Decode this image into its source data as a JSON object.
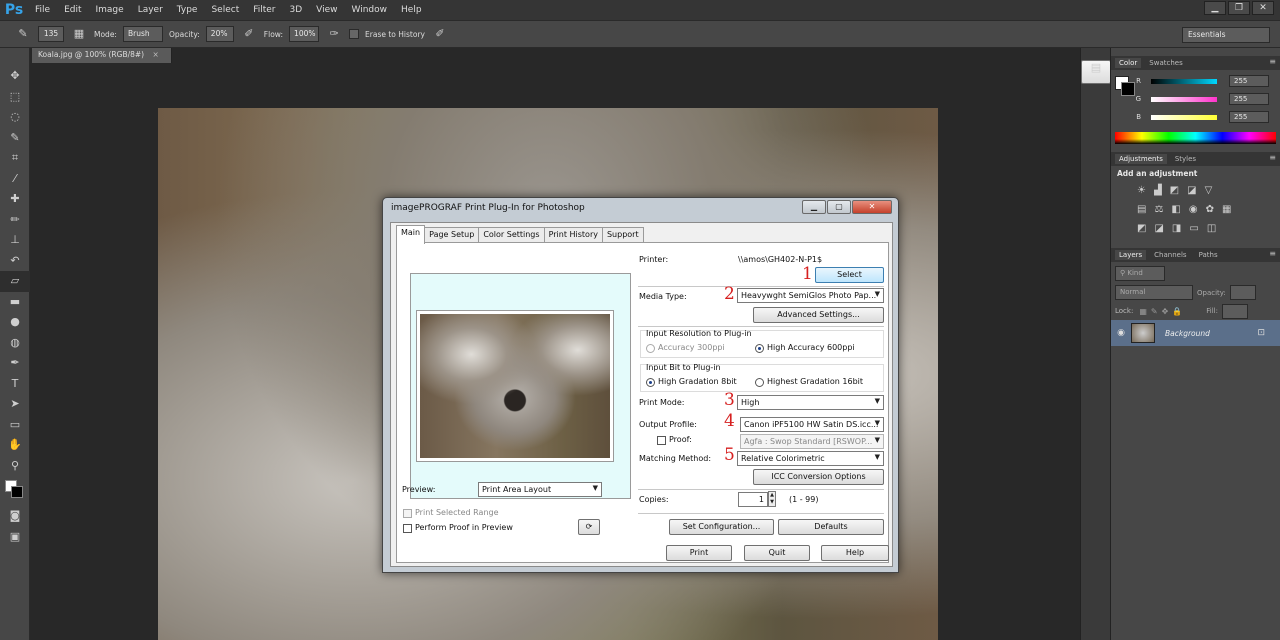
{
  "app": {
    "logo": "Ps",
    "menu": [
      "File",
      "Edit",
      "Image",
      "Layer",
      "Type",
      "Select",
      "Filter",
      "3D",
      "View",
      "Window",
      "Help"
    ],
    "window_controls": [
      "▁",
      "❐",
      "✕"
    ]
  },
  "options_bar": {
    "brush_size": "135",
    "mode_label": "Mode:",
    "mode_value": "Brush",
    "opacity_label": "Opacity:",
    "opacity_value": "20%",
    "flow_label": "Flow:",
    "flow_value": "100%",
    "erase_to_history": "Erase to History",
    "workspace": "Essentials"
  },
  "document": {
    "tab_title": "Koala.jpg @ 100% (RGB/8#)"
  },
  "panels": {
    "color_tabs": [
      "Color",
      "Swatches"
    ],
    "color": {
      "channels": [
        {
          "label": "R",
          "value": "255",
          "color": "#00d8ff"
        },
        {
          "label": "G",
          "value": "255",
          "color": "#ff33cc"
        },
        {
          "label": "B",
          "value": "255",
          "color": "#ffff33"
        }
      ]
    },
    "adjustment_tabs": [
      "Adjustments",
      "Styles"
    ],
    "add_adjustment": "Add an adjustment",
    "layers_tabs": [
      "Layers",
      "Channels",
      "Paths"
    ],
    "layers": {
      "kind_label": "Kind",
      "blend_mode": "Normal",
      "opacity_label": "Opacity:",
      "lock_label": "Lock:",
      "fill_label": "Fill:",
      "layer_name": "Background"
    }
  },
  "dialog": {
    "title": "imagePROGRAF Print Plug-In for Photoshop",
    "tabs": [
      "Main",
      "Page Setup",
      "Color Settings",
      "Print History",
      "Support"
    ],
    "printer_label": "Printer:",
    "printer_value": "\\\\amos\\GH402-N-P1$",
    "select_button": "Select",
    "media_type_label": "Media Type:",
    "media_type_value": "Heavywght SemiGlos Photo Pap...",
    "advanced_settings_button": "Advanced Settings...",
    "input_resolution_label": "Input Resolution to Plug-in",
    "accuracy_300": "Accuracy 300ppi",
    "high_accuracy_600": "High Accuracy 600ppi",
    "input_bit_label": "Input Bit to Plug-in",
    "high_gradation_8": "High Gradation 8bit",
    "highest_gradation_16": "Highest Gradation 16bit",
    "print_mode_label": "Print Mode:",
    "print_mode_value": "High",
    "output_profile_label": "Output Profile:",
    "output_profile_value": "Canon iPF5100 HW Satin DS.icc...",
    "proof_label": "Proof:",
    "proof_value": "Agfa : Swop Standard  [RSWOP...",
    "matching_method_label": "Matching Method:",
    "matching_method_value": "Relative Colorimetric",
    "icc_conversion_button": "ICC Conversion Options",
    "copies_label": "Copies:",
    "copies_value": "1",
    "copies_range": "(1 - 99)",
    "set_configuration_button": "Set Configuration...",
    "defaults_button": "Defaults",
    "preview_label": "Preview:",
    "preview_value": "Print Area Layout",
    "print_selected_range": "Print Selected Range",
    "perform_proof_in_preview": "Perform Proof in Preview",
    "print_button": "Print",
    "quit_button": "Quit",
    "help_button": "Help"
  },
  "annotations": [
    "1",
    "2",
    "3",
    "4",
    "5"
  ],
  "colors": {
    "annotation_red": "#d62020",
    "ps_blue": "#36a3e8",
    "selected_layer": "#5b6f8a"
  }
}
